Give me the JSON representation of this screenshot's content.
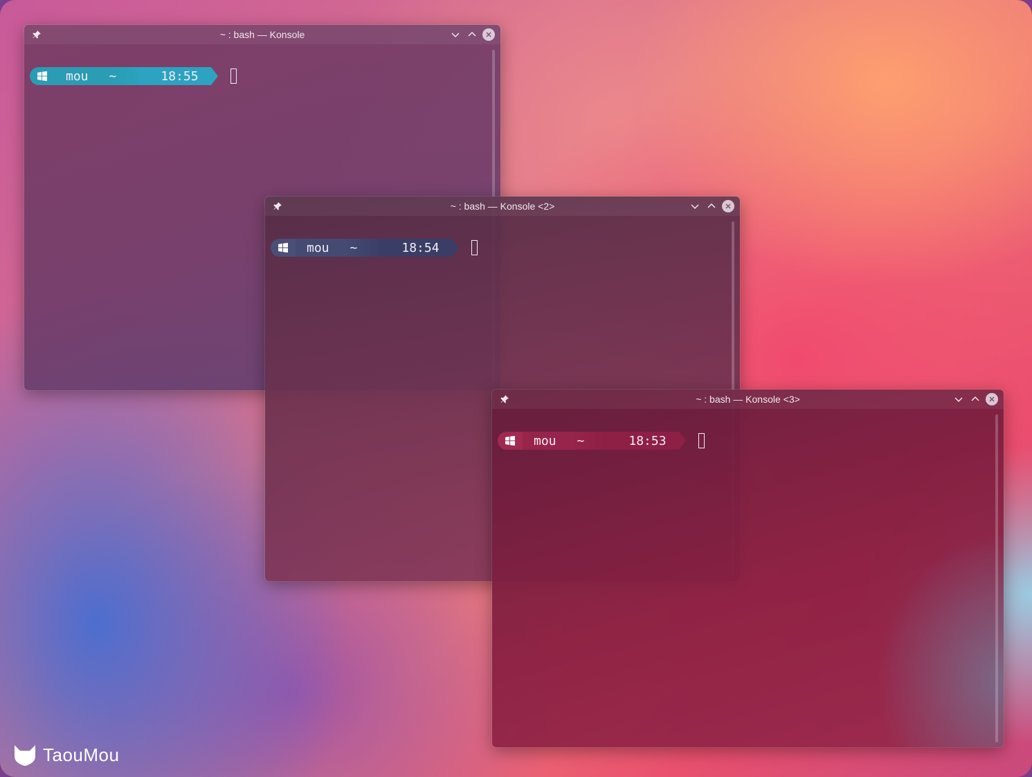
{
  "windows": [
    {
      "title": "~ : bash — Konsole",
      "prompt": {
        "user": "mou",
        "dir": "~",
        "time": "18:55"
      },
      "prompt_color": "#2aa0b8"
    },
    {
      "title": "~ : bash — Konsole <2>",
      "prompt": {
        "user": "mou",
        "dir": "~",
        "time": "18:54"
      },
      "prompt_color": "#3a3f66"
    },
    {
      "title": "~ : bash — Konsole <3>",
      "prompt": {
        "user": "mou",
        "dir": "~",
        "time": "18:53"
      },
      "prompt_color": "#8e1f45"
    }
  ],
  "icons": {
    "pin": "pin-icon",
    "minimize": "chevron-down-icon",
    "maximize": "chevron-up-icon",
    "close": "close-icon",
    "os": "windows-logo-icon",
    "brand": "fox-logo-icon"
  },
  "watermark": {
    "name": "TaouMou"
  }
}
